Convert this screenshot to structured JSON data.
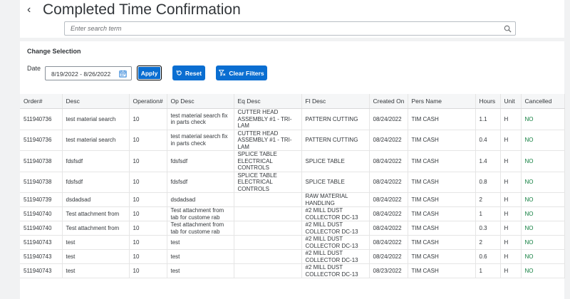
{
  "header": {
    "title": "Completed Time Confirmation",
    "search_placeholder": "Enter search term"
  },
  "filter": {
    "section_label": "Change Selection",
    "date_label": "Date",
    "date_value": "8/19/2022 - 8/26/2022",
    "apply_label": "Apply",
    "reset_label": "Reset",
    "clear_label": "Clear Filters"
  },
  "table": {
    "columns": [
      "Order#",
      "Desc",
      "Operation#",
      "Op Desc",
      "Eq Desc",
      "Fl Desc",
      "Created On",
      "Pers Name",
      "Hours",
      "Unit",
      "Cancelled"
    ],
    "rows": [
      [
        "511940736",
        "test material search",
        "10",
        "test material search fix in parts check",
        "CUTTER HEAD ASSEMBLY #1 - TRI-LAM",
        "PATTERN CUTTING",
        "08/24/2022",
        "TIM CASH",
        "1.1",
        "H",
        "NO"
      ],
      [
        "511940736",
        "test material search",
        "10",
        "test material search fix in parts check",
        "CUTTER HEAD ASSEMBLY #1 - TRI-LAM",
        "PATTERN CUTTING",
        "08/24/2022",
        "TIM CASH",
        "0.4",
        "H",
        "NO"
      ],
      [
        "511940738",
        "fdsfsdf",
        "10",
        "fdsfsdf",
        "SPLICE TABLE ELECTRICAL CONTROLS",
        "SPLICE TABLE",
        "08/24/2022",
        "TIM CASH",
        "1.4",
        "H",
        "NO"
      ],
      [
        "511940738",
        "fdsfsdf",
        "10",
        "fdsfsdf",
        "SPLICE TABLE ELECTRICAL CONTROLS",
        "SPLICE TABLE",
        "08/24/2022",
        "TIM CASH",
        "0.8",
        "H",
        "NO"
      ],
      [
        "511940739",
        "dsdadsad",
        "10",
        "dsdadsad",
        "",
        "RAW MATERIAL HANDLING",
        "08/24/2022",
        "TIM CASH",
        "2",
        "H",
        "NO"
      ],
      [
        "511940740",
        "Test attachment from",
        "10",
        "Test attachment from tab for custome rab",
        "",
        "#2 MILL DUST COLLECTOR DC-13",
        "08/24/2022",
        "TIM CASH",
        "1",
        "H",
        "NO"
      ],
      [
        "511940740",
        "Test attachment from",
        "10",
        "Test attachment from tab for custome rab",
        "",
        "#2 MILL DUST COLLECTOR DC-13",
        "08/24/2022",
        "TIM CASH",
        "0.3",
        "H",
        "NO"
      ],
      [
        "511940743",
        "test",
        "10",
        "test",
        "",
        "#2 MILL DUST COLLECTOR DC-13",
        "08/24/2022",
        "TIM CASH",
        "2",
        "H",
        "NO"
      ],
      [
        "511940743",
        "test",
        "10",
        "test",
        "",
        "#2 MILL DUST COLLECTOR DC-13",
        "08/24/2022",
        "TIM CASH",
        "0.6",
        "H",
        "NO"
      ],
      [
        "511940743",
        "test",
        "10",
        "test",
        "",
        "#2 MILL DUST COLLECTOR DC-13",
        "08/23/2022",
        "TIM CASH",
        "1",
        "H",
        "NO"
      ]
    ]
  }
}
